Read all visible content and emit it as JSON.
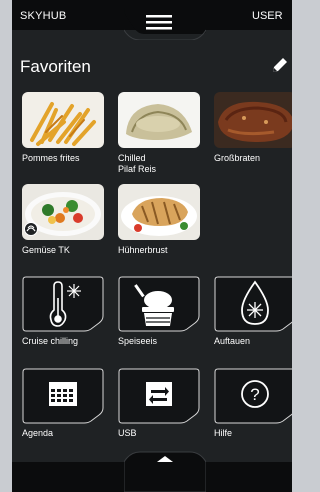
{
  "header": {
    "brand": "SKYHUB",
    "user": "USER"
  },
  "page": {
    "title": "Favoriten"
  },
  "favorites": [
    {
      "label": "Pommes frites"
    },
    {
      "label": "Chilled",
      "label2": "Pilaf Reis"
    },
    {
      "label": "Großbraten"
    },
    {
      "label": "Gemüse TK"
    },
    {
      "label": "Hühnerbrust"
    }
  ],
  "functions": [
    {
      "label": "Cruise chilling",
      "icon": "thermometer-snowflake-icon"
    },
    {
      "label": "Speiseeis",
      "icon": "ice-cream-icon"
    },
    {
      "label": "Auftauen",
      "icon": "drop-snowflake-icon"
    },
    {
      "label": "Agenda",
      "icon": "calendar-icon"
    },
    {
      "label": "USB",
      "icon": "usb-transfer-icon"
    },
    {
      "label": "Hilfe",
      "icon": "help-icon"
    }
  ],
  "colors": {
    "background": "#1f2224",
    "bar": "#0b0c0d",
    "accent": "#ffffff"
  }
}
